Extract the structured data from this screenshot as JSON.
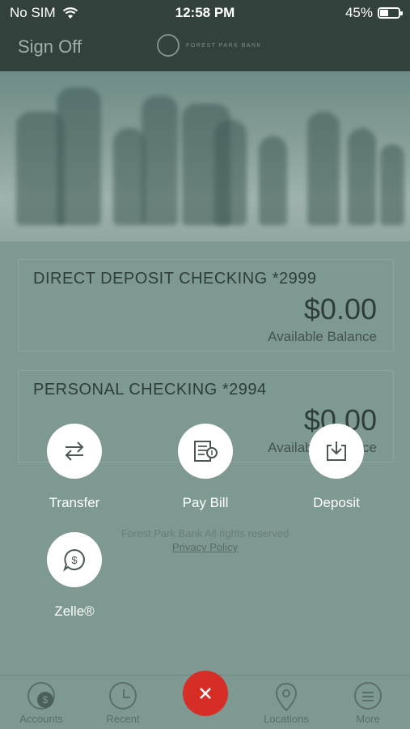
{
  "status_bar": {
    "carrier": "No SIM",
    "time": "12:58 PM",
    "battery": "45%",
    "battery_level": 0.45
  },
  "nav": {
    "sign_off": "Sign Off",
    "logo_text": "FOREST PARK BANK"
  },
  "accounts": [
    {
      "name": "DIRECT DEPOSIT CHECKING *2999",
      "amount": "$0.00",
      "caption": "Available Balance"
    },
    {
      "name": "PERSONAL CHECKING *2994",
      "amount": "$0.00",
      "caption": "Available Balance"
    }
  ],
  "footer": {
    "rights": "Forest Park Bank All rights reserved",
    "privacy": "Privacy Policy"
  },
  "actions": {
    "transfer": "Transfer",
    "pay_bill": "Pay Bill",
    "deposit": "Deposit",
    "zelle": "Zelle®"
  },
  "tabs": {
    "accounts": "Accounts",
    "recent": "Recent",
    "locations": "Locations",
    "more": "More"
  },
  "colors": {
    "overlay_bg": "#7e9992",
    "close_button": "#d72d27",
    "header": "#33413d"
  },
  "icons": [
    "wifi-icon",
    "battery-icon",
    "transfer-icon",
    "pay-bill-icon",
    "deposit-icon",
    "zelle-icon",
    "close-icon",
    "dollar-icon",
    "clock-icon",
    "location-pin-icon",
    "menu-icon"
  ]
}
